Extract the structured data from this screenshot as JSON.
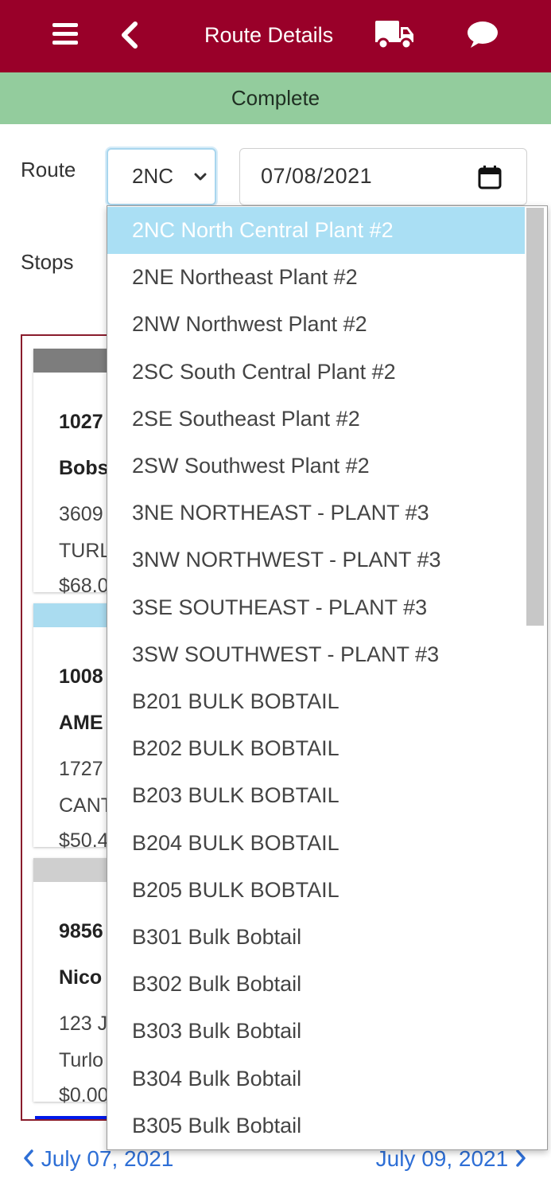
{
  "header": {
    "title": "Route Details",
    "menu_icon": "hamburger-menu-icon",
    "back_icon": "chevron-left-icon",
    "truck_icon": "truck-icon",
    "chat_icon": "chat-bubble-icon",
    "background": "#990029"
  },
  "status": {
    "label": "Complete",
    "color": "#93cc9d"
  },
  "form": {
    "route_label": "Route",
    "route_value": "2NC",
    "date_value": "07/08/2021",
    "stops_label": "Stops"
  },
  "stops": [
    {
      "number": "1027",
      "name": "Bobs",
      "address1": "3609",
      "address2": "TURL",
      "amount": "$68.0",
      "strip_color": "#7d7d7d"
    },
    {
      "number": "1008",
      "name": "AME",
      "address1": "1727",
      "address2": "CANT",
      "amount": "$50.4",
      "strip_color": "#aadcf0"
    },
    {
      "number": "9856",
      "name": "Nico",
      "address1": "123 J",
      "address2": "Turlo",
      "amount": "$0.00",
      "strip_color": "#cfcfcf"
    }
  ],
  "route_options": [
    "2NC North Central Plant #2",
    "2NE Northeast Plant #2",
    "2NW Northwest Plant #2",
    "2SC South Central Plant #2",
    "2SE Southeast Plant #2",
    "2SW Southwest Plant #2",
    "3NE NORTHEAST - PLANT #3",
    "3NW NORTHWEST - PLANT #3",
    "3SE SOUTHEAST - PLANT #3",
    "3SW SOUTHWEST - PLANT #3",
    "B201 BULK BOBTAIL",
    "B202 BULK BOBTAIL",
    "B203 BULK BOBTAIL",
    "B204 BULK BOBTAIL",
    "B205 BULK BOBTAIL",
    "B301 Bulk Bobtail",
    "B302 Bulk Bobtail",
    "B303 Bulk Bobtail",
    "B304 Bulk Bobtail",
    "B305 Bulk Bobtail"
  ],
  "selected_option_index": 0,
  "date_nav": {
    "prev": "July 07, 2021",
    "next": "July 09, 2021"
  }
}
